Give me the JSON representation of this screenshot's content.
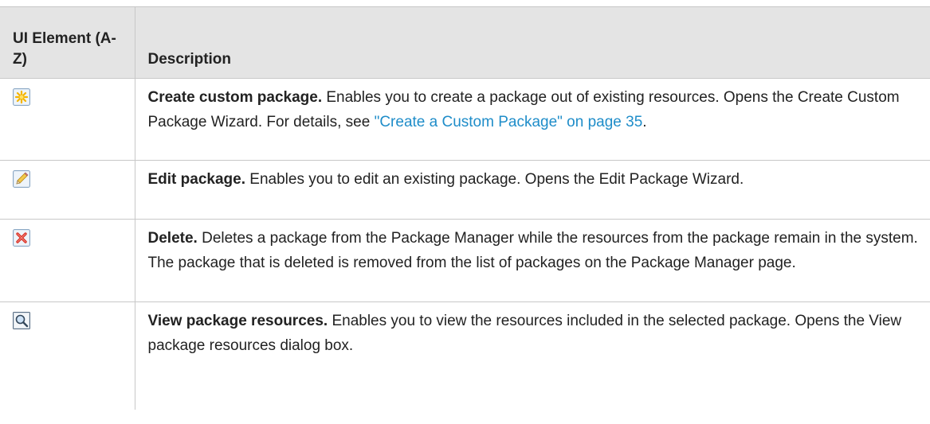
{
  "table": {
    "header": {
      "col1": "UI Element (A-Z)",
      "col2": "Description"
    },
    "rows": [
      {
        "icon": "new-star-icon",
        "term": "Create custom package.",
        "text": " Enables you to create a package out of existing resources. Opens the Create Custom Package Wizard. For details, see ",
        "link": "\"Create a Custom Package\" on page 35",
        "after": "."
      },
      {
        "icon": "pencil-edit-icon",
        "term": "Edit package.",
        "text": " Enables you to edit an existing package. Opens the Edit Package Wizard.",
        "link": "",
        "after": ""
      },
      {
        "icon": "red-x-delete-icon",
        "term": "Delete.",
        "text": " Deletes a package from the Package Manager while the resources from the package remain in the system. The package that is deleted is removed from the list of packages on the Package Manager page.",
        "link": "",
        "after": ""
      },
      {
        "icon": "magnifier-view-icon",
        "term": "View package resources.",
        "text": " Enables you to view the resources included in the selected package. Opens the View package resources dialog box.",
        "link": "",
        "after": ""
      }
    ]
  }
}
